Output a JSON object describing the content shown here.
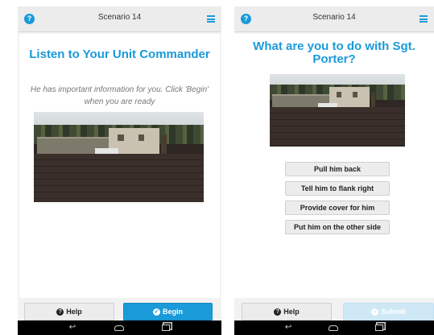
{
  "screens": [
    {
      "title": "Scenario 14",
      "heading": "Listen to Your Unit Commander",
      "instructions": "He has important information for you. Click 'Begin' when you are ready",
      "help_label": "Help",
      "primary_label": "Begin"
    },
    {
      "title": "Scenario 14",
      "question": "What are you to do with Sgt. Porter?",
      "choices": [
        "Pull him back",
        "Tell him to flank right",
        "Provide cover for him",
        "Put him on the other side"
      ],
      "help_label": "Help",
      "primary_label": "Submit",
      "primary_state": "disabled"
    }
  ],
  "colors": {
    "accent": "#1a9ad9",
    "disabled_accent": "#cfe8f6",
    "background": "#f2f2f2",
    "nav_bar": "#000000"
  },
  "icons": {
    "app_help": "help-circle-icon",
    "menu": "hamburger-menu-icon",
    "help_button": "question-circle-icon",
    "primary_button": "check-circle-icon",
    "nav": [
      "back-arrow-icon",
      "home-icon",
      "recent-apps-icon"
    ]
  }
}
